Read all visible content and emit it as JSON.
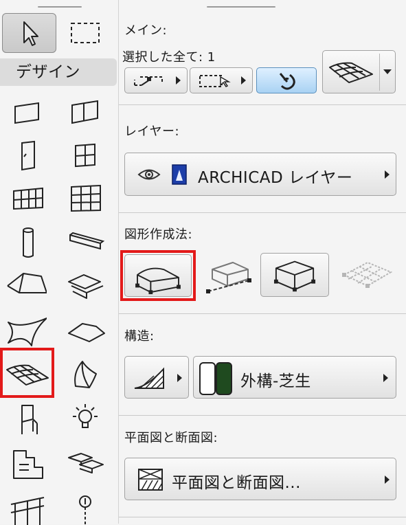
{
  "toolbox": {
    "section_label": "デザイン",
    "tools": [
      {
        "name": "wall-tool-icon"
      },
      {
        "name": "curtain-panel-tool-icon"
      },
      {
        "name": "door-tool-icon"
      },
      {
        "name": "window-tool-icon"
      },
      {
        "name": "curtain-wall-tool-icon"
      },
      {
        "name": "grid-panel-tool-icon"
      },
      {
        "name": "column-tool-icon"
      },
      {
        "name": "beam-tool-icon"
      },
      {
        "name": "roof-tool-icon"
      },
      {
        "name": "stair-tool-icon"
      },
      {
        "name": "shell-tool-icon"
      },
      {
        "name": "slab-tool-icon"
      },
      {
        "name": "mesh-tool-icon"
      },
      {
        "name": "morph-tool-icon"
      },
      {
        "name": "object-tool-icon"
      },
      {
        "name": "lamp-tool-icon"
      },
      {
        "name": "zone-tool-icon"
      },
      {
        "name": "stair-flight-tool-icon"
      },
      {
        "name": "railing-tool-icon"
      },
      {
        "name": "grid-element-tool-icon"
      }
    ],
    "selected_tool": "mesh-tool-icon"
  },
  "main": {
    "label": "メイン:",
    "selection_count": "選択した全て: 1"
  },
  "layer": {
    "label": "レイヤー:",
    "value": "ARCHICAD レイヤー"
  },
  "geometry": {
    "label": "図形作成法:",
    "selected_index": 0
  },
  "structure": {
    "label": "構造:",
    "material": "外構-芝生",
    "material_colors": [
      "#ffffff",
      "#1f4a1f"
    ]
  },
  "floorplan": {
    "label": "平面図と断面図:",
    "button_label": "平面図と断面図..."
  }
}
